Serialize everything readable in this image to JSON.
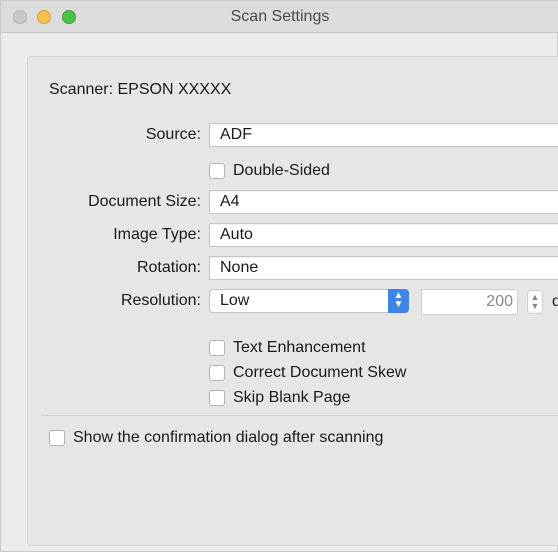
{
  "window": {
    "title": "Scan Settings"
  },
  "scanner": {
    "label": "Scanner: EPSON XXXXX"
  },
  "fields": {
    "source": {
      "label": "Source:",
      "value": "ADF"
    },
    "double_sided": {
      "label": "Double-Sided",
      "checked": false
    },
    "document_size": {
      "label": "Document Size:",
      "value": "A4"
    },
    "image_type": {
      "label": "Image Type:",
      "value": "Auto"
    },
    "rotation": {
      "label": "Rotation:",
      "value": "None"
    },
    "resolution": {
      "label": "Resolution:",
      "value": "Low",
      "number": "200",
      "unit_partial": "d"
    }
  },
  "options": [
    {
      "label": "Text Enhancement",
      "checked": false
    },
    {
      "label": "Correct Document Skew",
      "checked": false
    },
    {
      "label": "Skip Blank Page",
      "checked": false
    }
  ],
  "confirmation": {
    "label": "Show the confirmation dialog after scanning",
    "checked": false
  },
  "icons": {
    "select_stepper": "chevron-up-down-icon",
    "number_stepper": "stepper-icon"
  },
  "colors": {
    "accent": "#3d86e6",
    "traffic_minimize": "#f6be4f",
    "traffic_zoom": "#4cc24b"
  }
}
